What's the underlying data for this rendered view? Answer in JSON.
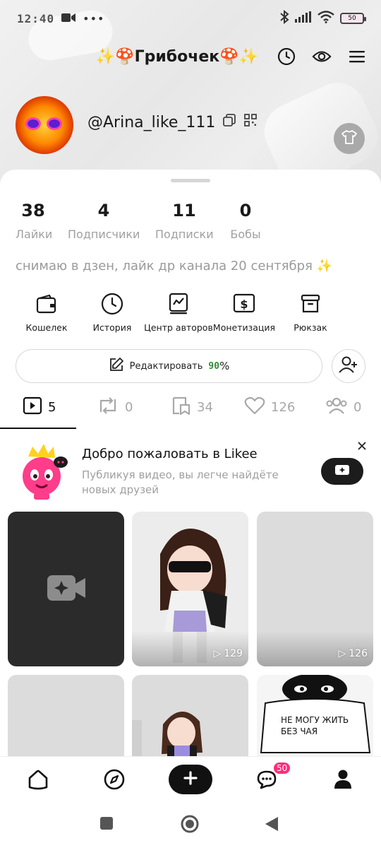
{
  "status_bar": {
    "time": "12:40",
    "battery": "50"
  },
  "header": {
    "title": "✨🍄Грибочек🍄✨"
  },
  "profile": {
    "username": "@Arina_like_111"
  },
  "stats": [
    {
      "value": "38",
      "label": "Лайки"
    },
    {
      "value": "4",
      "label": "Подписчики"
    },
    {
      "value": "11",
      "label": "Подписки"
    },
    {
      "value": "0",
      "label": "Бобы"
    }
  ],
  "bio": "снимаю в дзен, лайк др канала 20 сентября ✨",
  "actions": [
    {
      "label": "Кошелек",
      "icon": "wallet-icon"
    },
    {
      "label": "История",
      "icon": "clock-icon"
    },
    {
      "label": "Центр авторов",
      "icon": "chart-icon"
    },
    {
      "label": "Монетизация",
      "icon": "dollar-icon"
    },
    {
      "label": "Рюкзак",
      "icon": "backpack-icon"
    }
  ],
  "edit": {
    "label": "Редактировать",
    "percent": "90",
    "percent_sign": "%"
  },
  "tabs": [
    {
      "count": "5",
      "icon": "video-play-icon"
    },
    {
      "count": "0",
      "icon": "repost-icon"
    },
    {
      "count": "34",
      "icon": "saved-icon"
    },
    {
      "count": "126",
      "icon": "heart-icon"
    },
    {
      "count": "0",
      "icon": "group-icon"
    }
  ],
  "welcome": {
    "title": "Добро пожаловать в Likee",
    "subtitle": "Публикуя видео, вы легче найдёте новых друзей"
  },
  "videos": [
    {
      "views": "",
      "type": "upload"
    },
    {
      "views": "129"
    },
    {
      "views": "126"
    },
    {
      "views": ""
    },
    {
      "views": ""
    },
    {
      "views": "",
      "caption": "НЕ МОГУ ЖИТЬ БЕЗ ЧАЯ"
    }
  ],
  "bottom_nav": {
    "messages_badge": "50"
  },
  "colors": {
    "badge": "#ff2d7a",
    "edit_percent": "#2e8b2e"
  }
}
